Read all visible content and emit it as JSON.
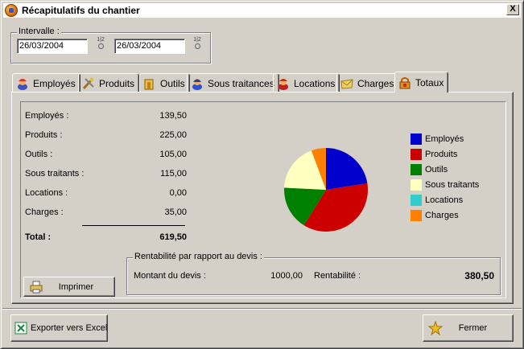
{
  "window": {
    "title": "Récapitulatifs du chantier",
    "close_label": "X"
  },
  "interval": {
    "label": "Intervalle :",
    "start": "26/03/2004",
    "end": "26/03/2004"
  },
  "tabs": [
    {
      "label": "Employés",
      "icon": "worker-icon"
    },
    {
      "label": "Produits",
      "icon": "tools-icon"
    },
    {
      "label": "Outils",
      "icon": "toolbox-icon"
    },
    {
      "label": "Sous traitances",
      "icon": "helmet-icon"
    },
    {
      "label": "Locations",
      "icon": "truck-icon"
    },
    {
      "label": "Charges",
      "icon": "envelope-icon"
    },
    {
      "label": "Totaux",
      "icon": "lock-icon",
      "active": true
    }
  ],
  "summary": {
    "rows": [
      {
        "label": "Employés :",
        "value": "139,50"
      },
      {
        "label": "Produits :",
        "value": "225,00"
      },
      {
        "label": "Outils :",
        "value": "105,00"
      },
      {
        "label": "Sous traitants :",
        "value": "115,00"
      },
      {
        "label": "Locations :",
        "value": "0,00"
      },
      {
        "label": "Charges :",
        "value": "35,00"
      }
    ],
    "total_label": "Total :",
    "total_value": "619,50"
  },
  "rentabilite": {
    "title": "Rentabilité par rapport au devis :",
    "devis_label": "Montant du devis :",
    "devis_value": "1000,00",
    "rentabilite_label": "Rentabilité :",
    "rentabilite_value": "380,50"
  },
  "buttons": {
    "print": "Imprimer",
    "export": "Exporter vers Excel",
    "close": "Fermer"
  },
  "chart_data": {
    "type": "pie",
    "categories": [
      "Employés",
      "Produits",
      "Outils",
      "Sous traitants",
      "Locations",
      "Charges"
    ],
    "values": [
      139.5,
      225.0,
      105.0,
      115.0,
      0.0,
      35.0
    ],
    "colors": [
      "#0000cc",
      "#cc0000",
      "#008000",
      "#ffffc0",
      "#33cccc",
      "#ff8000"
    ],
    "legend_position": "right"
  }
}
